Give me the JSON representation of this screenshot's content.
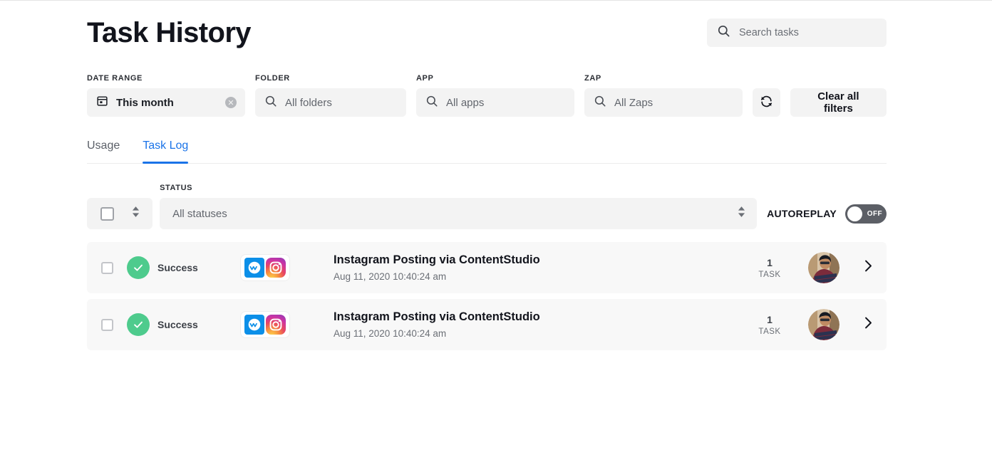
{
  "header": {
    "title": "Task History",
    "search": {
      "placeholder": "Search tasks",
      "value": "",
      "icon": "search-icon"
    }
  },
  "filters": {
    "date_range": {
      "label": "DATE RANGE",
      "value": "This month",
      "icon": "calendar-icon",
      "clear_glyph": "✕"
    },
    "folder": {
      "label": "FOLDER",
      "placeholder": "All folders",
      "icon": "search-icon"
    },
    "app": {
      "label": "APP",
      "placeholder": "All apps",
      "icon": "search-icon"
    },
    "zap": {
      "label": "ZAP",
      "placeholder": "All Zaps",
      "icon": "search-icon"
    },
    "refresh": {
      "icon": "refresh-icon"
    },
    "clear_all": {
      "label": "Clear all filters"
    }
  },
  "tabs": [
    {
      "label": "Usage",
      "active": false
    },
    {
      "label": "Task Log",
      "active": true
    }
  ],
  "status_bar": {
    "select_all": {
      "checked": false,
      "sort_icon": "sort-updown-icon"
    },
    "status": {
      "label": "STATUS",
      "placeholder": "All statuses",
      "sort_icon": "sort-updown-icon"
    },
    "autoreplay": {
      "label": "AUTOREPLAY",
      "state": "OFF",
      "on": false
    }
  },
  "tasks": [
    {
      "checked": false,
      "status": "Success",
      "status_color": "#4ecb8d",
      "apps": [
        "contentstudio-icon",
        "instagram-icon"
      ],
      "title": "Instagram Posting via ContentStudio",
      "time": "Aug 11, 2020 10:40:24 am",
      "count": "1",
      "count_unit": "TASK",
      "avatar": "user-avatar",
      "chevron": "chevron-right-icon"
    },
    {
      "checked": false,
      "status": "Success",
      "status_color": "#4ecb8d",
      "apps": [
        "contentstudio-icon",
        "instagram-icon"
      ],
      "title": "Instagram Posting via ContentStudio",
      "time": "Aug 11, 2020 10:40:24 am",
      "count": "1",
      "count_unit": "TASK",
      "avatar": "user-avatar",
      "chevron": "chevron-right-icon"
    }
  ],
  "colors": {
    "accent_blue": "#1a73e8",
    "success_green": "#4ecb8d",
    "field_gray": "#f3f3f3",
    "row_gray": "#f8f8f8",
    "text_dark": "#12141c",
    "text_muted": "#6b6f76",
    "toggle_off": "#5c5f66"
  }
}
